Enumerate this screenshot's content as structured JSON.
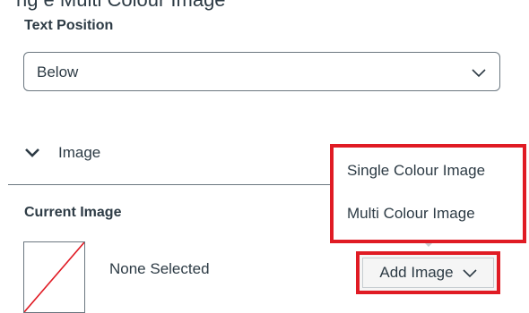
{
  "top_fragment": "rig e Multi Colour Image",
  "text_position": {
    "label": "Text Position",
    "selected_value": "Below"
  },
  "image_section": {
    "toggle_label": "Image"
  },
  "current_image": {
    "label": "Current Image",
    "status": "None Selected"
  },
  "add_image_button": {
    "label": "Add Image"
  },
  "add_image_menu": {
    "items": [
      "Single Colour Image",
      "Multi Colour Image"
    ]
  },
  "colors": {
    "highlight": "#e01b24",
    "text": "#2d3b45",
    "border": "#6b7780",
    "button_bg": "#f5f5f5"
  },
  "icons": [
    "chevron-down-icon",
    "chevron-down-icon",
    "no-image-placeholder"
  ]
}
